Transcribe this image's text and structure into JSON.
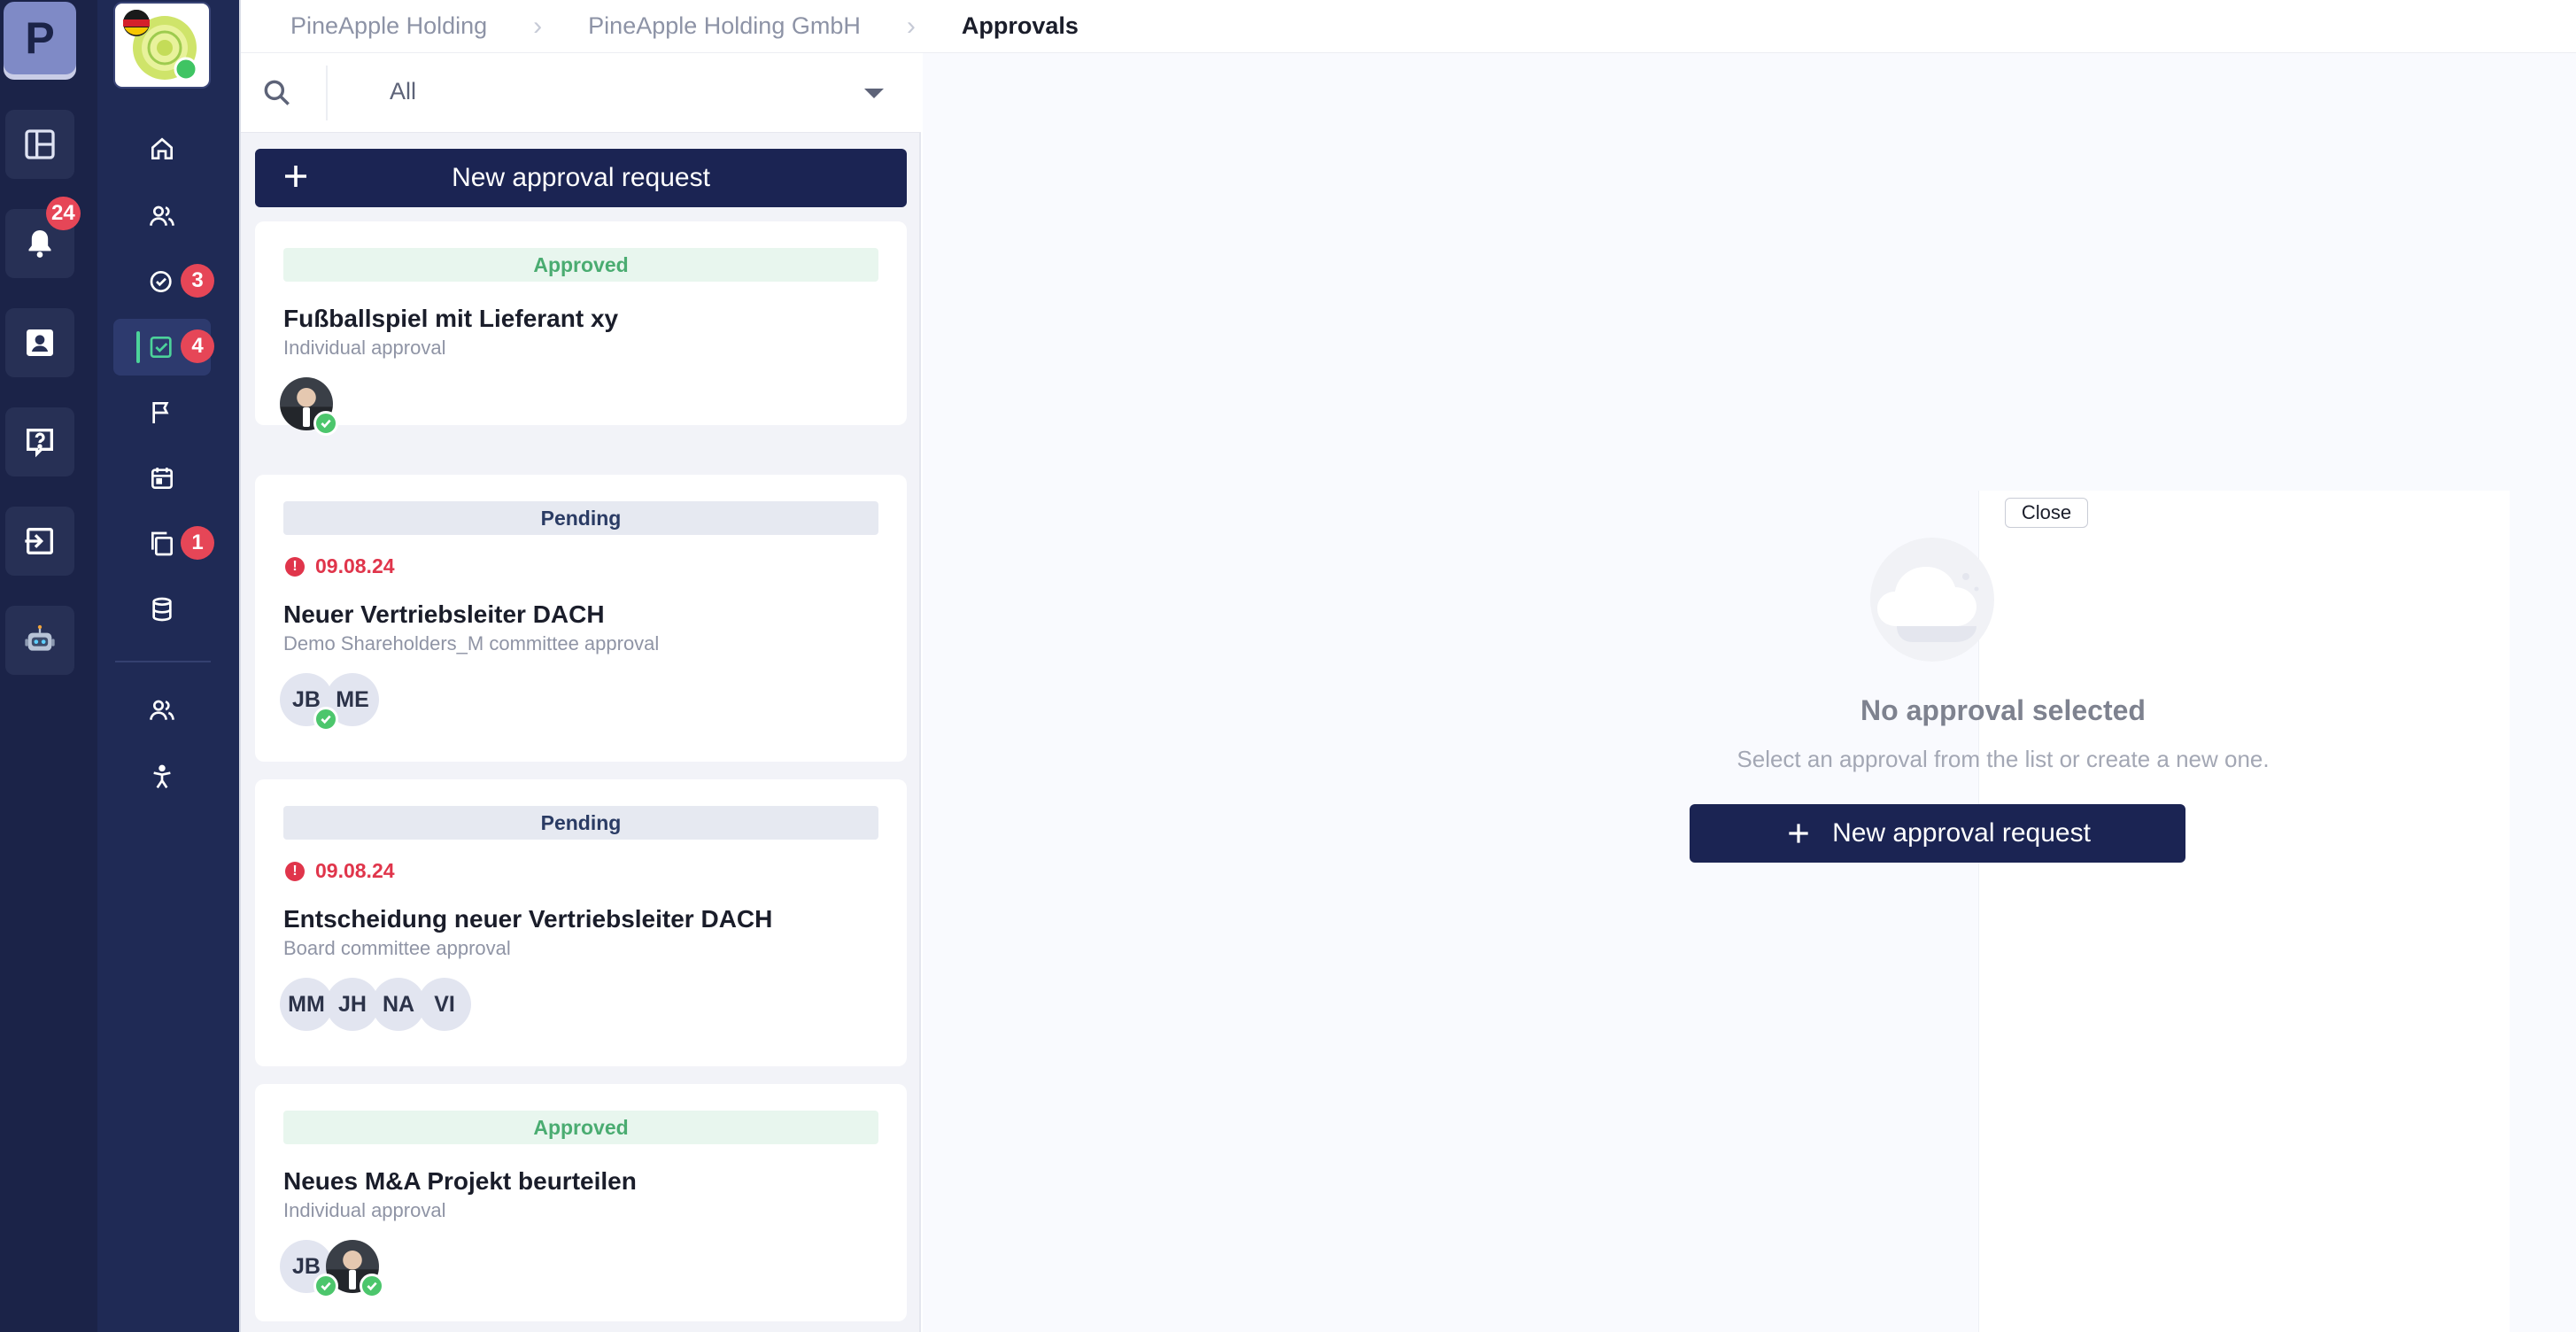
{
  "rail1": {
    "brand_letter": "P",
    "notifications_badge": "24"
  },
  "rail2": {
    "tasks_badge": "3",
    "approvals_badge": "4",
    "documents_badge": "1"
  },
  "breadcrumb": [
    "PineApple Holding",
    "PineApple Holding GmbH",
    "Approvals"
  ],
  "filter": {
    "selected": "All"
  },
  "list": {
    "new_button_label": "New approval request",
    "cards": [
      {
        "status": "Approved",
        "status_type": "approved",
        "due": "",
        "title": "Fußballspiel mit Lieferant xy",
        "subtitle": "Individual approval",
        "avatars": [
          {
            "initials": "",
            "photo": true,
            "approved": true
          }
        ]
      },
      {
        "status": "Pending",
        "status_type": "pending",
        "due": "09.08.24",
        "title": "Neuer Vertriebsleiter DACH",
        "subtitle": "Demo Shareholders_M committee approval",
        "avatars": [
          {
            "initials": "JB",
            "photo": false,
            "approved": true
          },
          {
            "initials": "ME",
            "photo": false,
            "approved": false
          }
        ]
      },
      {
        "status": "Pending",
        "status_type": "pending",
        "due": "09.08.24",
        "title": "Entscheidung neuer Vertriebsleiter DACH",
        "subtitle": "Board committee approval",
        "avatars": [
          {
            "initials": "MM",
            "photo": false,
            "approved": false
          },
          {
            "initials": "JH",
            "photo": false,
            "approved": false
          },
          {
            "initials": "NA",
            "photo": false,
            "approved": false
          },
          {
            "initials": "VI",
            "photo": false,
            "approved": false
          }
        ]
      },
      {
        "status": "Approved",
        "status_type": "approved",
        "due": "",
        "title": "Neues M&A Projekt beurteilen",
        "subtitle": "Individual approval",
        "avatars": [
          {
            "initials": "JB",
            "photo": false,
            "approved": true
          },
          {
            "initials": "",
            "photo": true,
            "approved": true
          }
        ]
      }
    ]
  },
  "detail": {
    "close_label": "Close",
    "empty_title": "No approval selected",
    "empty_subtitle": "Select an approval from the list or create a new one.",
    "new_button_label": "New approval request"
  },
  "icons": {
    "rail1": [
      "layout-icon",
      "bell-icon",
      "contact-card-icon",
      "help-icon",
      "logout-icon",
      "robot-icon"
    ],
    "rail2": [
      "home-icon",
      "people-icon",
      "tasks-icon",
      "approvals-icon",
      "flag-icon",
      "calendar-icon",
      "documents-icon",
      "database-icon",
      "team-icon",
      "accessibility-icon"
    ]
  },
  "colors": {
    "navy": "#1b2453",
    "approved": "#4aac71",
    "danger": "#e0354b"
  }
}
